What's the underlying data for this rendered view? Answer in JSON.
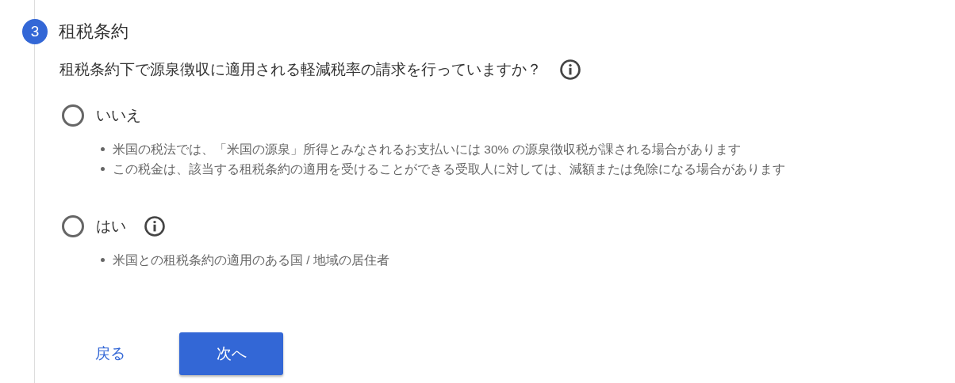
{
  "step": {
    "number": "3",
    "title": "租税条約"
  },
  "question": {
    "text": "租税条約下で源泉徴収に適用される軽減税率の請求を行っていますか？",
    "info": true
  },
  "options": [
    {
      "label": "いいえ",
      "selected": false,
      "info": false,
      "notes": [
        "米国の税法では、「米国の源泉」所得とみなされるお支払いには 30% の源泉徴収税が課される場合があります",
        "この税金は、該当する租税条約の適用を受けることができる受取人に対しては、減額または免除になる場合があります"
      ]
    },
    {
      "label": "はい",
      "selected": false,
      "info": true,
      "notes": [
        "米国との租税条約の適用のある国 / 地域の居住者"
      ]
    }
  ],
  "buttons": {
    "back": "戻る",
    "next": "次へ"
  }
}
